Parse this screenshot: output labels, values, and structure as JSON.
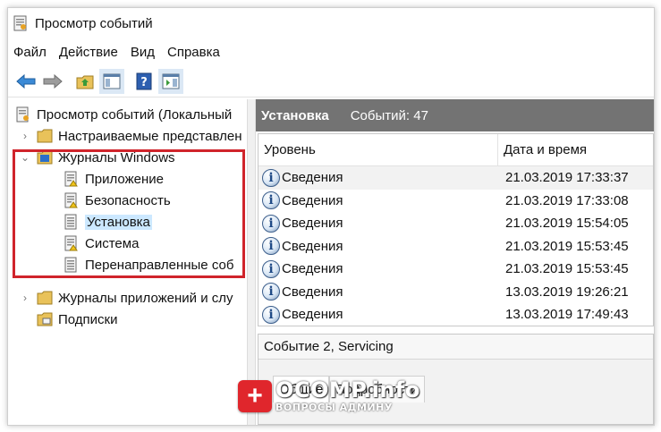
{
  "window": {
    "title": "Просмотр событий"
  },
  "menu": [
    "Файл",
    "Действие",
    "Вид",
    "Справка"
  ],
  "toolbar": {
    "buttons": [
      "back-arrow-icon",
      "forward-arrow-icon",
      "folder-up-icon",
      "show-hide-tree-icon",
      "help-icon",
      "action-pane-icon"
    ]
  },
  "tree": {
    "root": "Просмотр событий (Локальный",
    "custom_views": "Настраиваемые представлен",
    "windows_logs": "Журналы Windows",
    "windows_logs_children": [
      "Приложение",
      "Безопасность",
      "Установка",
      "Система",
      "Перенаправленные соб"
    ],
    "selected": "Установка",
    "app_logs": "Журналы приложений и слу",
    "subscriptions": "Подписки"
  },
  "right": {
    "header_title": "Установка",
    "header_count": "Событий: 47",
    "columns": [
      "Уровень",
      "Дата и время"
    ],
    "events": [
      {
        "level": "Сведения",
        "datetime": "21.03.2019 17:33:37"
      },
      {
        "level": "Сведения",
        "datetime": "21.03.2019 17:33:08"
      },
      {
        "level": "Сведения",
        "datetime": "21.03.2019 15:54:05"
      },
      {
        "level": "Сведения",
        "datetime": "21.03.2019 15:53:45"
      },
      {
        "level": "Сведения",
        "datetime": "21.03.2019 15:53:45"
      },
      {
        "level": "Сведения",
        "datetime": "13.03.2019 19:26:21"
      },
      {
        "level": "Сведения",
        "datetime": "13.03.2019 17:49:43"
      }
    ],
    "detail_title": "Событие 2, Servicing",
    "tabs": [
      "Общие",
      "Подробности"
    ]
  },
  "watermark": {
    "badge": "+",
    "main": "OCOMP.info",
    "sub": "ВОПРОСЫ АДМИНУ"
  },
  "colors": {
    "highlight_box": "#d0242b",
    "header_bg": "#737373",
    "selection": "#cce8ff"
  }
}
